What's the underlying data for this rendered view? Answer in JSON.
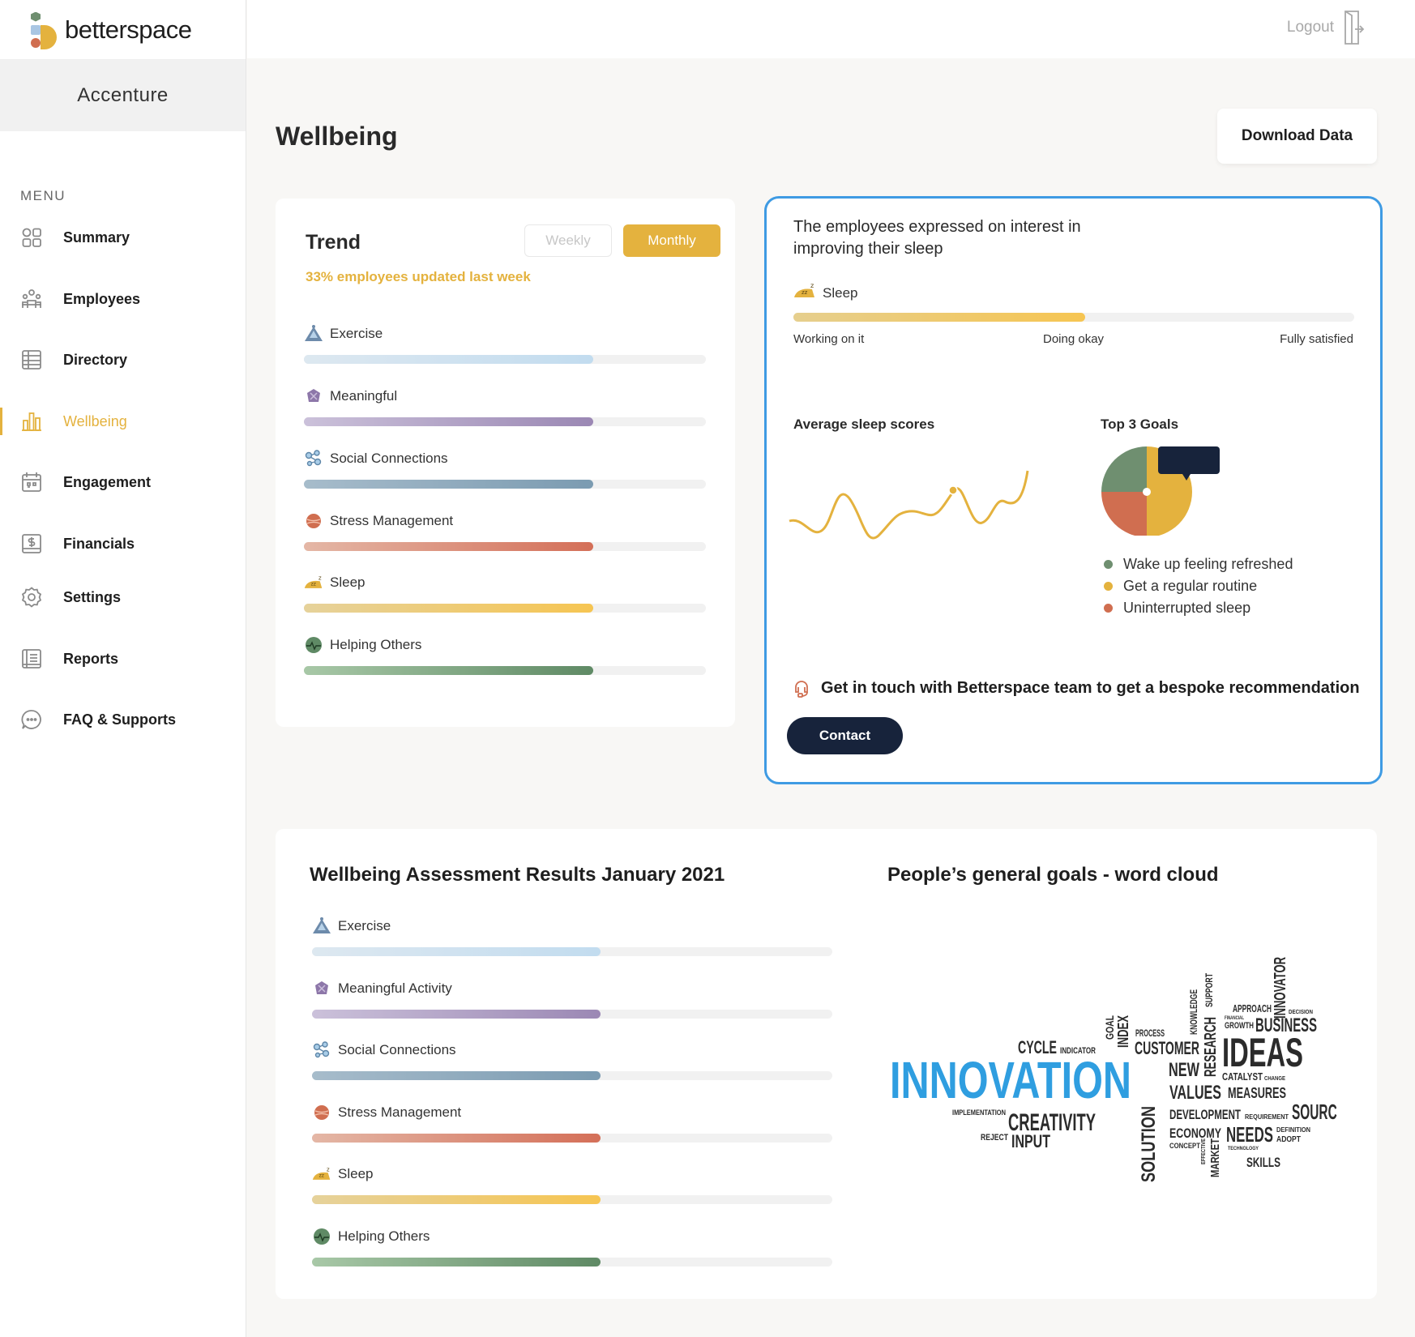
{
  "brand": {
    "name": "betterspace",
    "org": "Accenture"
  },
  "menu": {
    "label": "MENU",
    "items": [
      {
        "label": "Summary",
        "icon": "grid-icon"
      },
      {
        "label": "Employees",
        "icon": "people-icon"
      },
      {
        "label": "Directory",
        "icon": "table-icon"
      },
      {
        "label": "Wellbeing",
        "icon": "bar-chart-icon",
        "active": true
      },
      {
        "label": "Engagement",
        "icon": "calendar-icon"
      },
      {
        "label": "Financials",
        "icon": "dollar-icon"
      },
      {
        "label": "Settings",
        "icon": "gear-icon"
      },
      {
        "label": "Reports",
        "icon": "report-icon"
      },
      {
        "label": "FAQ & Supports",
        "icon": "chat-icon"
      }
    ]
  },
  "header": {
    "logout": "Logout"
  },
  "page": {
    "title": "Wellbeing",
    "download": "Download Data"
  },
  "trend": {
    "title": "Trend",
    "weekly": "Weekly",
    "monthly": "Monthly",
    "subtitle": "33% employees updated last week",
    "metrics": [
      {
        "label": "Exercise",
        "value": 0.72,
        "color_from": "#dde8f0",
        "color_to": "#c2dcef"
      },
      {
        "label": "Meaningful",
        "value": 0.72,
        "color_from": "#cbc1da",
        "color_to": "#9b88b4"
      },
      {
        "label": "Social Connections",
        "value": 0.72,
        "color_from": "#a7bccb",
        "color_to": "#7b9bb1"
      },
      {
        "label": "Stress Management",
        "value": 0.72,
        "color_from": "#e4b7a6",
        "color_to": "#d46f58"
      },
      {
        "label": "Sleep",
        "value": 0.72,
        "color_from": "#e6d29b",
        "color_to": "#f6c552"
      },
      {
        "label": "Helping Others",
        "value": 0.72,
        "color_from": "#a8c8a7",
        "color_to": "#5f8a65"
      }
    ]
  },
  "insight": {
    "text": "The employees expressed on interest in improving their sleep",
    "metric": "Sleep",
    "level": 0.52,
    "scale": [
      "Working on it",
      "Doing okay",
      "Fully satisfied"
    ],
    "avg_title": "Average sleep scores",
    "goals_title": "Top 3 Goals",
    "goals": [
      {
        "label": "Wake up feeling refreshed",
        "color": "#6f8f70"
      },
      {
        "label": "Get a regular routine",
        "color": "#e4b23e"
      },
      {
        "label": "Uninterrupted sleep",
        "color": "#d06e50"
      }
    ],
    "cta": "Get in touch with Betterspace team to get a bespoke recommendation",
    "contact": "Contact"
  },
  "assessment": {
    "title": "Wellbeing Assessment Results January 2021",
    "metrics": [
      {
        "label": "Exercise",
        "value": 0.555
      },
      {
        "label": "Meaningful Activity",
        "value": 0.555
      },
      {
        "label": "Social Connections",
        "value": 0.555
      },
      {
        "label": "Stress Management",
        "value": 0.555
      },
      {
        "label": "Sleep",
        "value": 0.555
      },
      {
        "label": "Helping Others",
        "value": 0.555
      }
    ]
  },
  "cloud": {
    "title": "People’s general goals - word cloud",
    "words": [
      "INNOVATION",
      "IDEAS",
      "BUSINESS",
      "CREATIVITY",
      "CUSTOMER",
      "CYCLE",
      "INDICATOR",
      "GOAL",
      "INDEX",
      "PROCESS",
      "KNOWLEDGE",
      "SUPPORT",
      "RESEARCH",
      "APPROACH",
      "FINANCIAL",
      "GROWTH",
      "INNOVATOR",
      "DECISION",
      "NEW",
      "VALUES",
      "CATALYST",
      "CHANGE",
      "MEASURES",
      "IMPLEMENTATION",
      "REJECT",
      "INPUT",
      "SOLUTION",
      "DEVELOPMENT",
      "REQUIREMENT",
      "SOURCE",
      "ECONOMY",
      "CONCEPT",
      "NEEDS",
      "DEFINITION",
      "ADOPT",
      "TECHNOLOGY",
      "EFFECTIVE",
      "MARKET",
      "SKILLS"
    ]
  }
}
